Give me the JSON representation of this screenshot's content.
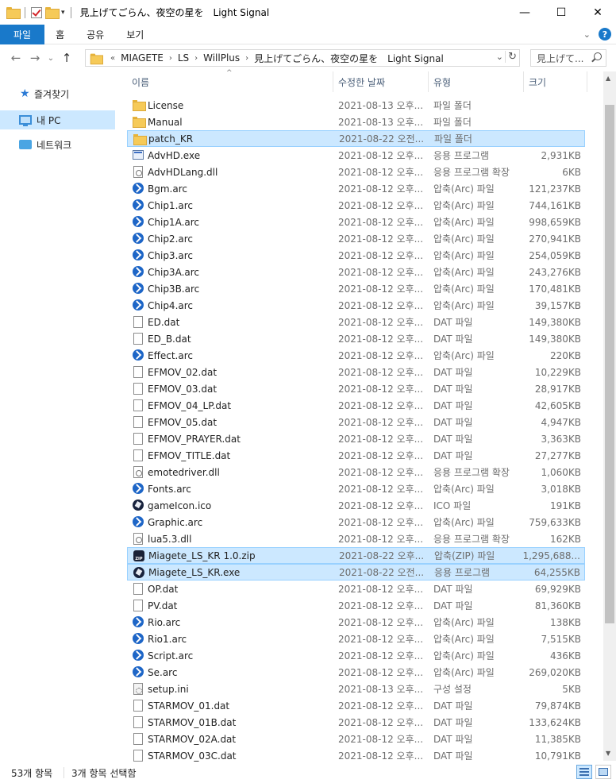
{
  "window": {
    "title": "見上げてごらん、夜空の星を　Light Signal",
    "minimize": "—",
    "maximize": "☐",
    "close": "✕"
  },
  "ribbon": {
    "tabs": [
      "파일",
      "홈",
      "공유",
      "보기"
    ],
    "collapse_caret": "⌄",
    "help": "?"
  },
  "nav": {
    "back": "←",
    "forward": "→",
    "recent": "⌄",
    "up": "↑"
  },
  "address": {
    "overflow": "«",
    "crumbs": [
      "MIAGETE",
      "LS",
      "WillPlus",
      "見上げてごらん、夜空の星を　Light Signal"
    ],
    "separator": "›",
    "dropdown": "⌄",
    "refresh": "↻"
  },
  "search": {
    "placeholder": "見上げて..."
  },
  "navpane": {
    "items": [
      {
        "label": "즐겨찾기",
        "icon": "star-icon"
      },
      {
        "label": "내 PC",
        "icon": "pc-icon",
        "selected": true
      },
      {
        "label": "네트워크",
        "icon": "network-icon"
      }
    ]
  },
  "columns": {
    "name": "이름",
    "date": "수정한 날짜",
    "type": "유형",
    "size": "크기",
    "sort_arrow": "^"
  },
  "files": [
    {
      "name": "License",
      "date": "2021-08-13 오후...",
      "type": "파일 폴더",
      "size": "",
      "icon": "folder"
    },
    {
      "name": "Manual",
      "date": "2021-08-13 오후...",
      "type": "파일 폴더",
      "size": "",
      "icon": "folder"
    },
    {
      "name": "patch_KR",
      "date": "2021-08-22 오전...",
      "type": "파일 폴더",
      "size": "",
      "icon": "folder",
      "selected": true
    },
    {
      "name": "AdvHD.exe",
      "date": "2021-08-12 오후...",
      "type": "응용 프로그램",
      "size": "2,931KB",
      "icon": "exe"
    },
    {
      "name": "AdvHDLang.dll",
      "date": "2021-08-12 오후...",
      "type": "응용 프로그램 확장",
      "size": "6KB",
      "icon": "dll"
    },
    {
      "name": "Bgm.arc",
      "date": "2021-08-12 오후...",
      "type": "압축(Arc) 파일",
      "size": "121,237KB",
      "icon": "arc"
    },
    {
      "name": "Chip1.arc",
      "date": "2021-08-12 오후...",
      "type": "압축(Arc) 파일",
      "size": "744,161KB",
      "icon": "arc"
    },
    {
      "name": "Chip1A.arc",
      "date": "2021-08-12 오후...",
      "type": "압축(Arc) 파일",
      "size": "998,659KB",
      "icon": "arc"
    },
    {
      "name": "Chip2.arc",
      "date": "2021-08-12 오후...",
      "type": "압축(Arc) 파일",
      "size": "270,941KB",
      "icon": "arc"
    },
    {
      "name": "Chip3.arc",
      "date": "2021-08-12 오후...",
      "type": "압축(Arc) 파일",
      "size": "254,059KB",
      "icon": "arc"
    },
    {
      "name": "Chip3A.arc",
      "date": "2021-08-12 오후...",
      "type": "압축(Arc) 파일",
      "size": "243,276KB",
      "icon": "arc"
    },
    {
      "name": "Chip3B.arc",
      "date": "2021-08-12 오후...",
      "type": "압축(Arc) 파일",
      "size": "170,481KB",
      "icon": "arc"
    },
    {
      "name": "Chip4.arc",
      "date": "2021-08-12 오후...",
      "type": "압축(Arc) 파일",
      "size": "39,157KB",
      "icon": "arc"
    },
    {
      "name": "ED.dat",
      "date": "2021-08-12 오후...",
      "type": "DAT 파일",
      "size": "149,380KB",
      "icon": "file"
    },
    {
      "name": "ED_B.dat",
      "date": "2021-08-12 오후...",
      "type": "DAT 파일",
      "size": "149,380KB",
      "icon": "file"
    },
    {
      "name": "Effect.arc",
      "date": "2021-08-12 오후...",
      "type": "압축(Arc) 파일",
      "size": "220KB",
      "icon": "arc"
    },
    {
      "name": "EFMOV_02.dat",
      "date": "2021-08-12 오후...",
      "type": "DAT 파일",
      "size": "10,229KB",
      "icon": "file"
    },
    {
      "name": "EFMOV_03.dat",
      "date": "2021-08-12 오후...",
      "type": "DAT 파일",
      "size": "28,917KB",
      "icon": "file"
    },
    {
      "name": "EFMOV_04_LP.dat",
      "date": "2021-08-12 오후...",
      "type": "DAT 파일",
      "size": "42,605KB",
      "icon": "file"
    },
    {
      "name": "EFMOV_05.dat",
      "date": "2021-08-12 오후...",
      "type": "DAT 파일",
      "size": "4,947KB",
      "icon": "file"
    },
    {
      "name": "EFMOV_PRAYER.dat",
      "date": "2021-08-12 오후...",
      "type": "DAT 파일",
      "size": "3,363KB",
      "icon": "file"
    },
    {
      "name": "EFMOV_TITLE.dat",
      "date": "2021-08-12 오후...",
      "type": "DAT 파일",
      "size": "27,277KB",
      "icon": "file"
    },
    {
      "name": "emotedriver.dll",
      "date": "2021-08-12 오후...",
      "type": "응용 프로그램 확장",
      "size": "1,060KB",
      "icon": "dll"
    },
    {
      "name": "Fonts.arc",
      "date": "2021-08-12 오후...",
      "type": "압축(Arc) 파일",
      "size": "3,018KB",
      "icon": "arc"
    },
    {
      "name": "gameIcon.ico",
      "date": "2021-08-12 오후...",
      "type": "ICO 파일",
      "size": "191KB",
      "icon": "ico"
    },
    {
      "name": "Graphic.arc",
      "date": "2021-08-12 오후...",
      "type": "압축(Arc) 파일",
      "size": "759,633KB",
      "icon": "arc"
    },
    {
      "name": "lua5.3.dll",
      "date": "2021-08-12 오후...",
      "type": "응용 프로그램 확장",
      "size": "162KB",
      "icon": "dll"
    },
    {
      "name": "Miagete_LS_KR 1.0.zip",
      "date": "2021-08-22 오후...",
      "type": "압축(ZIP) 파일",
      "size": "1,295,688...",
      "icon": "zip",
      "selected": true
    },
    {
      "name": "Miagete_LS_KR.exe",
      "date": "2021-08-22 오전...",
      "type": "응용 프로그램",
      "size": "64,255KB",
      "icon": "ico",
      "selected": true
    },
    {
      "name": "OP.dat",
      "date": "2021-08-12 오후...",
      "type": "DAT 파일",
      "size": "69,929KB",
      "icon": "file"
    },
    {
      "name": "PV.dat",
      "date": "2021-08-12 오후...",
      "type": "DAT 파일",
      "size": "81,360KB",
      "icon": "file"
    },
    {
      "name": "Rio.arc",
      "date": "2021-08-12 오후...",
      "type": "압축(Arc) 파일",
      "size": "138KB",
      "icon": "arc"
    },
    {
      "name": "Rio1.arc",
      "date": "2021-08-12 오후...",
      "type": "압축(Arc) 파일",
      "size": "7,515KB",
      "icon": "arc"
    },
    {
      "name": "Script.arc",
      "date": "2021-08-12 오후...",
      "type": "압축(Arc) 파일",
      "size": "436KB",
      "icon": "arc"
    },
    {
      "name": "Se.arc",
      "date": "2021-08-12 오후...",
      "type": "압축(Arc) 파일",
      "size": "269,020KB",
      "icon": "arc"
    },
    {
      "name": "setup.ini",
      "date": "2021-08-13 오후...",
      "type": "구성 설정",
      "size": "5KB",
      "icon": "ini"
    },
    {
      "name": "STARMOV_01.dat",
      "date": "2021-08-12 오후...",
      "type": "DAT 파일",
      "size": "79,874KB",
      "icon": "file"
    },
    {
      "name": "STARMOV_01B.dat",
      "date": "2021-08-12 오후...",
      "type": "DAT 파일",
      "size": "133,624KB",
      "icon": "file"
    },
    {
      "name": "STARMOV_02A.dat",
      "date": "2021-08-12 오후...",
      "type": "DAT 파일",
      "size": "11,385KB",
      "icon": "file"
    },
    {
      "name": "STARMOV_03C.dat",
      "date": "2021-08-12 오후...",
      "type": "DAT 파일",
      "size": "10,791KB",
      "icon": "file"
    }
  ],
  "scrollbar": {
    "up": "▲",
    "down": "▼"
  },
  "status": {
    "count": "53개 항목",
    "selection": "3개 항목 선택함"
  },
  "colors": {
    "accent": "#1979ca",
    "selection_bg": "#cce8ff",
    "selection_border": "#99d1ff"
  }
}
